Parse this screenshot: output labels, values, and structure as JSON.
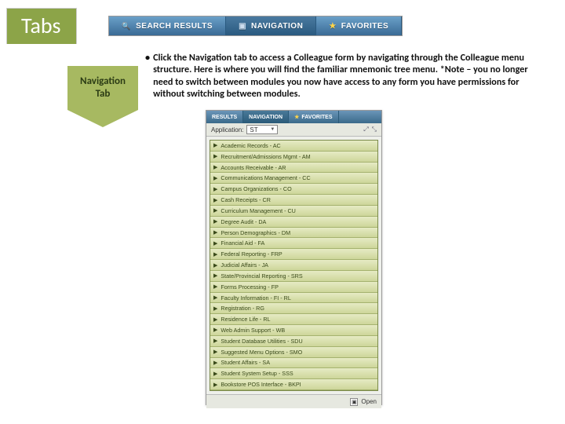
{
  "header": {
    "badge": "Tabs"
  },
  "topTabs": {
    "search": "SEARCH RESULTS",
    "navigation": "NAVIGATION",
    "favorites": "FAVORITES"
  },
  "leftChevron": {
    "line1": "Navigation",
    "line2": "Tab"
  },
  "description": "Click the Navigation tab to access a Colleague form by navigating through the Colleague menu structure. Here is where you will find the familiar mnemonic tree menu. *Note – you no longer need to switch between modules you now have access to any form you have permissions for without switching between modules.",
  "appShot": {
    "tabs": {
      "results": "RESULTS",
      "navigation": "NAVIGATION",
      "favorites": "FAVORITES"
    },
    "appLabel": "Application:",
    "appValue": "ST",
    "menuItems": [
      "Academic Records - AC",
      "Recruitment/Admissions Mgmt - AM",
      "Accounts Receivable - AR",
      "Communications Management - CC",
      "Campus Organizations - CO",
      "Cash Receipts - CR",
      "Curriculum Management - CU",
      "Degree Audit - DA",
      "Person Demographics - DM",
      "Financial Aid - FA",
      "Federal Reporting - FRP",
      "Judicial Affairs - JA",
      "State/Provincial Reporting - SRS",
      "Forms Processing - FP",
      "Faculty Information - FI - RL",
      "Registration - RG",
      "Residence Life - RL",
      "Web Admin Support - WB",
      "Student Database Utilities - SDU",
      "Suggested Menu Options - SMO",
      "Student Affairs - SA",
      "Student System Setup - SSS",
      "Bookstore POS Interface - BKPI"
    ],
    "footer": {
      "open": "Open"
    }
  }
}
